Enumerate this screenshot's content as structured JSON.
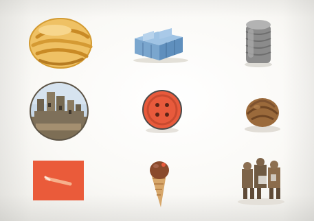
{
  "grid": {
    "rows": 3,
    "columns": 3,
    "items": [
      {
        "icon": "cookie-stack-icon",
        "color": "#e9b54c"
      },
      {
        "icon": "blue-building-icon",
        "color": "#7fa9cf"
      },
      {
        "icon": "metal-can-icon",
        "color": "#8b8b8b"
      },
      {
        "icon": "castle-photo-icon",
        "color": "#8a7a5c"
      },
      {
        "icon": "orange-button-icon",
        "color": "#e85a3c"
      },
      {
        "icon": "walnut-icon",
        "color": "#9a6a3c"
      },
      {
        "icon": "orange-square-icon",
        "color": "#ea5b3a"
      },
      {
        "icon": "ice-cream-cone-icon",
        "color": "#8a4a2c"
      },
      {
        "icon": "toy-figures-icon",
        "color": "#7a6248"
      }
    ]
  }
}
